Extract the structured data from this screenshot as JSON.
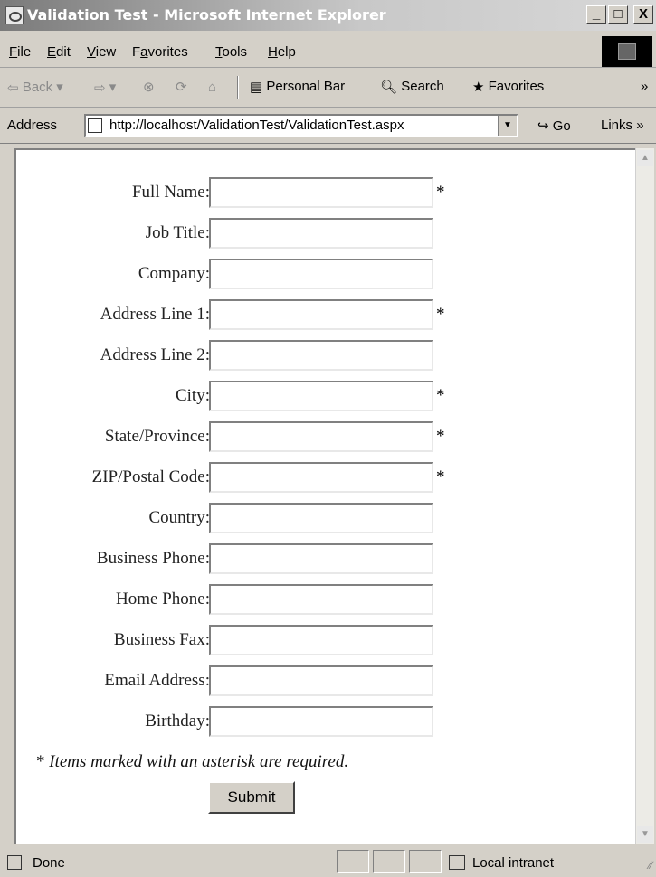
{
  "window": {
    "title": "Validation Test - Microsoft Internet Explorer"
  },
  "title_buttons": {
    "minimize": "_",
    "maximize": "□",
    "close": "X"
  },
  "menu": {
    "items": [
      {
        "label": "File",
        "hotkey": "F"
      },
      {
        "label": "Edit",
        "hotkey": "E"
      },
      {
        "label": "View",
        "hotkey": "V"
      },
      {
        "label": "Favorites",
        "hotkey": "a"
      },
      {
        "label": "Tools",
        "hotkey": "T"
      },
      {
        "label": "Help",
        "hotkey": "H"
      }
    ]
  },
  "toolbar": {
    "back_label": "Back",
    "personal_bar_label": "Personal Bar",
    "search_label": "Search",
    "favorites_label": "Favorites",
    "chevron": "»"
  },
  "address": {
    "label": "Address",
    "url": "http://localhost/ValidationTest/ValidationTest.aspx",
    "go_label": "Go",
    "links_label": "Links",
    "links_chevron": "»"
  },
  "form": {
    "fields": [
      {
        "label": "Full Name:",
        "value": "",
        "required": true
      },
      {
        "label": "Job Title:",
        "value": "",
        "required": false
      },
      {
        "label": "Company:",
        "value": "",
        "required": false
      },
      {
        "label": "Address Line 1:",
        "value": "",
        "required": true
      },
      {
        "label": "Address Line 2:",
        "value": "",
        "required": false
      },
      {
        "label": "City:",
        "value": "",
        "required": true
      },
      {
        "label": "State/Province:",
        "value": "",
        "required": true
      },
      {
        "label": "ZIP/Postal Code:",
        "value": "",
        "required": true
      },
      {
        "label": "Country:",
        "value": "",
        "required": false
      },
      {
        "label": "Business Phone:",
        "value": "",
        "required": false
      },
      {
        "label": "Home Phone:",
        "value": "",
        "required": false
      },
      {
        "label": "Business Fax:",
        "value": "",
        "required": false
      },
      {
        "label": "Email Address:",
        "value": "",
        "required": false
      },
      {
        "label": "Birthday:",
        "value": "",
        "required": false
      }
    ],
    "required_marker": "*",
    "note_marker": "*",
    "note_text": "Items marked with an asterisk are required.",
    "submit_label": "Submit"
  },
  "status": {
    "text": "Done",
    "zone": "Local intranet"
  }
}
